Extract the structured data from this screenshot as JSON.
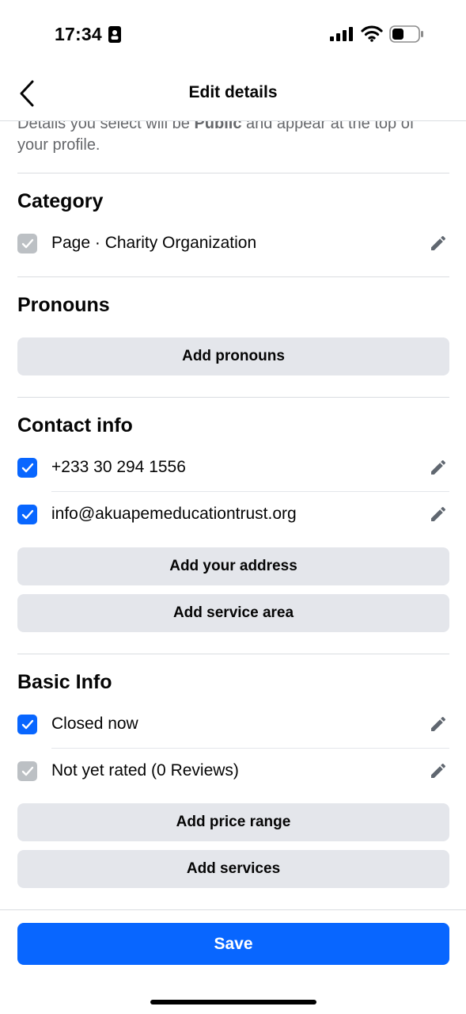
{
  "status_bar": {
    "time": "17:34",
    "icons": [
      "id-card-icon",
      "cellular-signal-icon",
      "wifi-icon",
      "battery-icon"
    ]
  },
  "header": {
    "title": "Edit details",
    "back_icon": "chevron-left-icon"
  },
  "intro": {
    "text_before": "Details you select will be ",
    "bold": "Public",
    "text_after": " and appear at the top of your profile."
  },
  "sections": {
    "category": {
      "title": "Category",
      "items": [
        {
          "label": "Page · Charity Organization",
          "checked": true,
          "disabled": true
        }
      ]
    },
    "pronouns": {
      "title": "Pronouns",
      "buttons": [
        "Add pronouns"
      ]
    },
    "contact": {
      "title": "Contact info",
      "items": [
        {
          "label": "+233 30 294 1556",
          "checked": true
        },
        {
          "label": "info@akuapemeducationtrust.org",
          "checked": true
        }
      ],
      "buttons": [
        "Add your address",
        "Add service area"
      ]
    },
    "basic": {
      "title": "Basic Info",
      "items": [
        {
          "label": "Closed now",
          "checked": true
        },
        {
          "label": "Not yet rated (0 Reviews)",
          "checked": true,
          "disabled": true
        }
      ],
      "buttons": [
        "Add price range",
        "Add services"
      ]
    }
  },
  "footer": {
    "save_label": "Save"
  },
  "colors": {
    "accent": "#0866ff",
    "button_gray": "#e4e6eb",
    "disabled_check": "#bcc0c4",
    "secondary_text": "#65676b"
  }
}
